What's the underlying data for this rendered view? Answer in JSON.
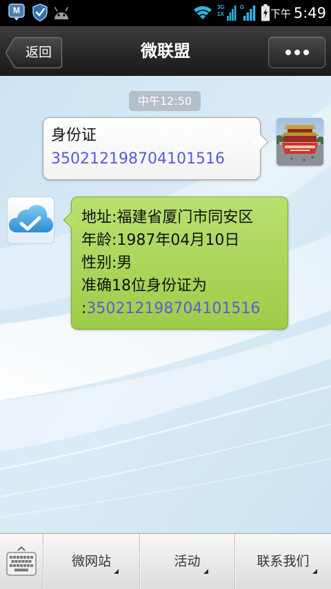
{
  "status_bar": {
    "app_icon_letter": "M",
    "signal_1_network": "3G",
    "signal_1_secondary": "1X",
    "signal_2_network": "G",
    "period": "下午",
    "time": "5:49"
  },
  "header": {
    "back_label": "返回",
    "title": "微联盟"
  },
  "chat": {
    "timestamp": "中午12:50",
    "messages": {
      "sent": {
        "text": "身份证",
        "link": "350212198704101516"
      },
      "received": {
        "lines": [
          "地址:福建省厦门市同安区",
          "年龄:1987年04月10日",
          "性别:男",
          "准确18位身份证为"
        ],
        "link_prefix": ":",
        "link": "350212198704101516"
      }
    }
  },
  "bottom_bar": {
    "menu": [
      {
        "label": "微网站"
      },
      {
        "label": "活动"
      },
      {
        "label": "联系我们"
      }
    ]
  },
  "icons": {
    "status_left": [
      "app-m-icon",
      "shield-check-icon",
      "android-icon"
    ],
    "status_right": [
      "wifi-icon",
      "signal-icon",
      "signal-icon",
      "battery-charging-icon"
    ],
    "header_more": "more-icon",
    "keyboard_toggle": "keyboard-icon",
    "menu_indicator": "menu-triangle-icon",
    "sent_avatar": "user-photo-avatar",
    "received_avatar": "cloud-check-avatar"
  },
  "colors": {
    "status_bar_bg": "#000000",
    "status_icon": "#33b5e5",
    "chat_bg": "#d2e6f3",
    "timestamp_pill": "#b5bfc7",
    "outgoing_bubble": "#ffffff",
    "incoming_bubble": "#a8d84c",
    "link": "#5a5ad8",
    "message_text": "#111111",
    "menu_text": "#333333"
  }
}
